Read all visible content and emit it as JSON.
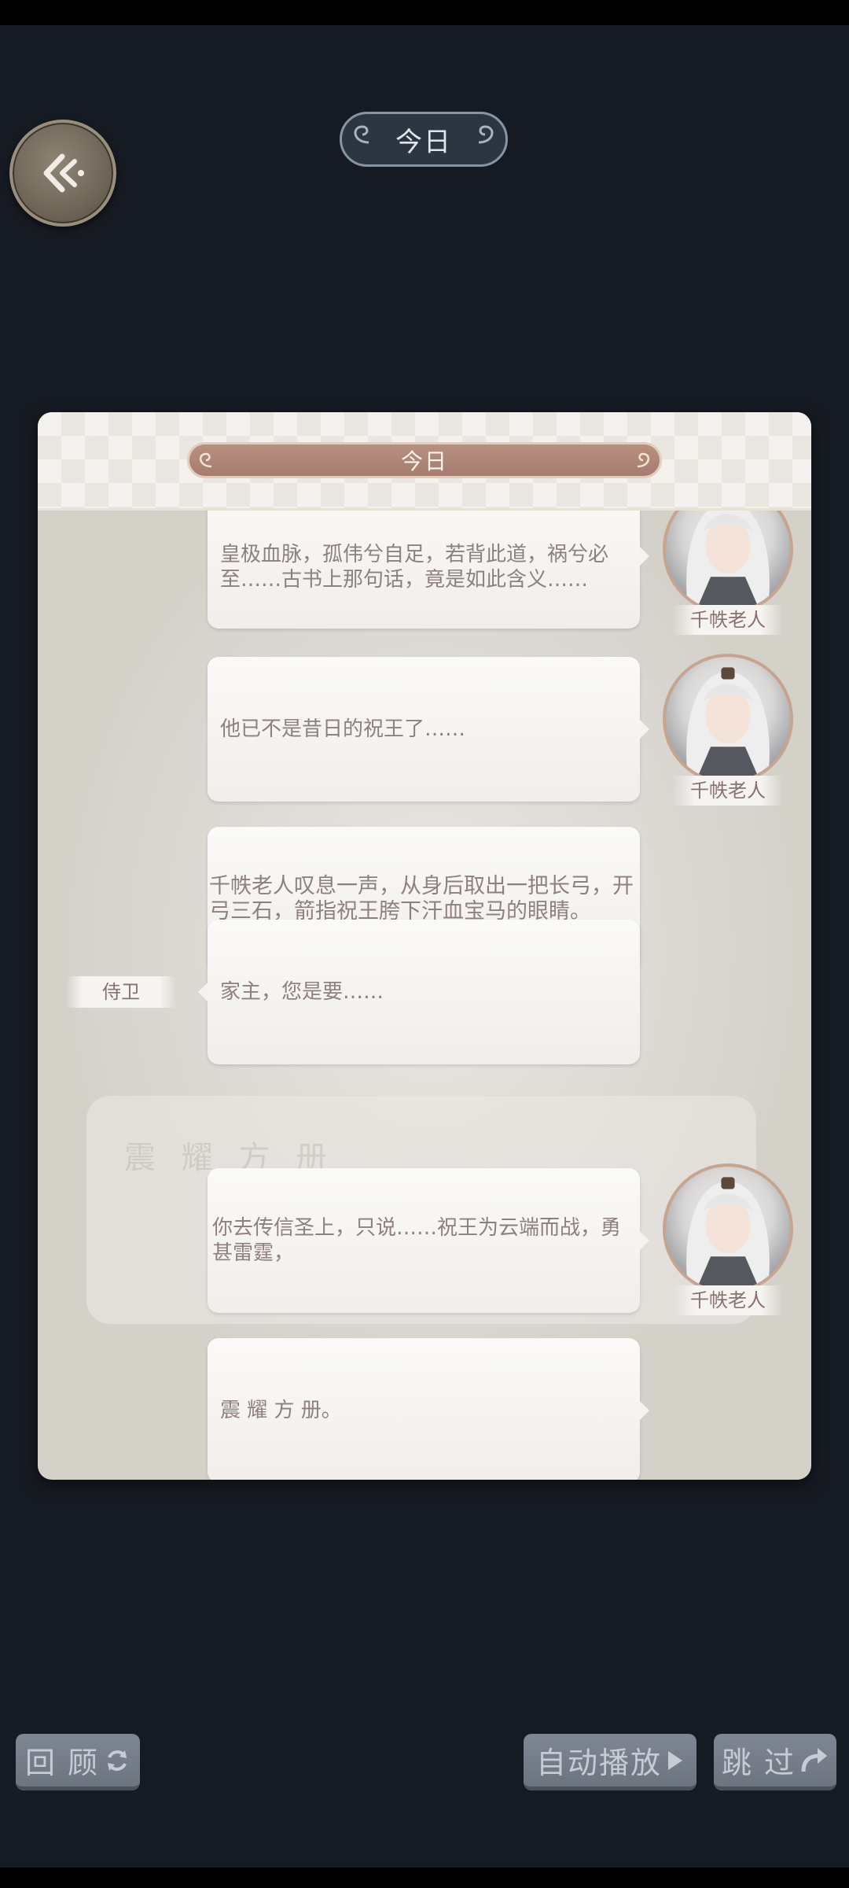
{
  "top": {
    "date_label": "今日"
  },
  "panel": {
    "title": "今日",
    "ghost_text": "震 耀 方 册",
    "messages": [
      {
        "speaker": "千帙老人",
        "text": "皇极血脉，孤伟兮自足，若背此道，祸兮必至……古书上那句话，竟是如此含义……"
      },
      {
        "speaker": "千帙老人",
        "text": "他已不是昔日的祝王了……"
      },
      {
        "speaker": "",
        "text": "千帙老人叹息一声，从身后取出一把长弓，开弓三石，箭指祝王胯下汗血宝马的眼睛。"
      },
      {
        "speaker": "侍卫",
        "text": "家主，您是要……"
      },
      {
        "speaker": "千帙老人",
        "text": "你去传信圣上，只说……祝王为云端而战，勇甚雷霆，"
      },
      {
        "speaker": "",
        "text": "震 耀 方 册。"
      }
    ]
  },
  "controls": {
    "review_label": "回 顾",
    "autoplay_label": "自动播放",
    "skip_label": "跳 过"
  }
}
